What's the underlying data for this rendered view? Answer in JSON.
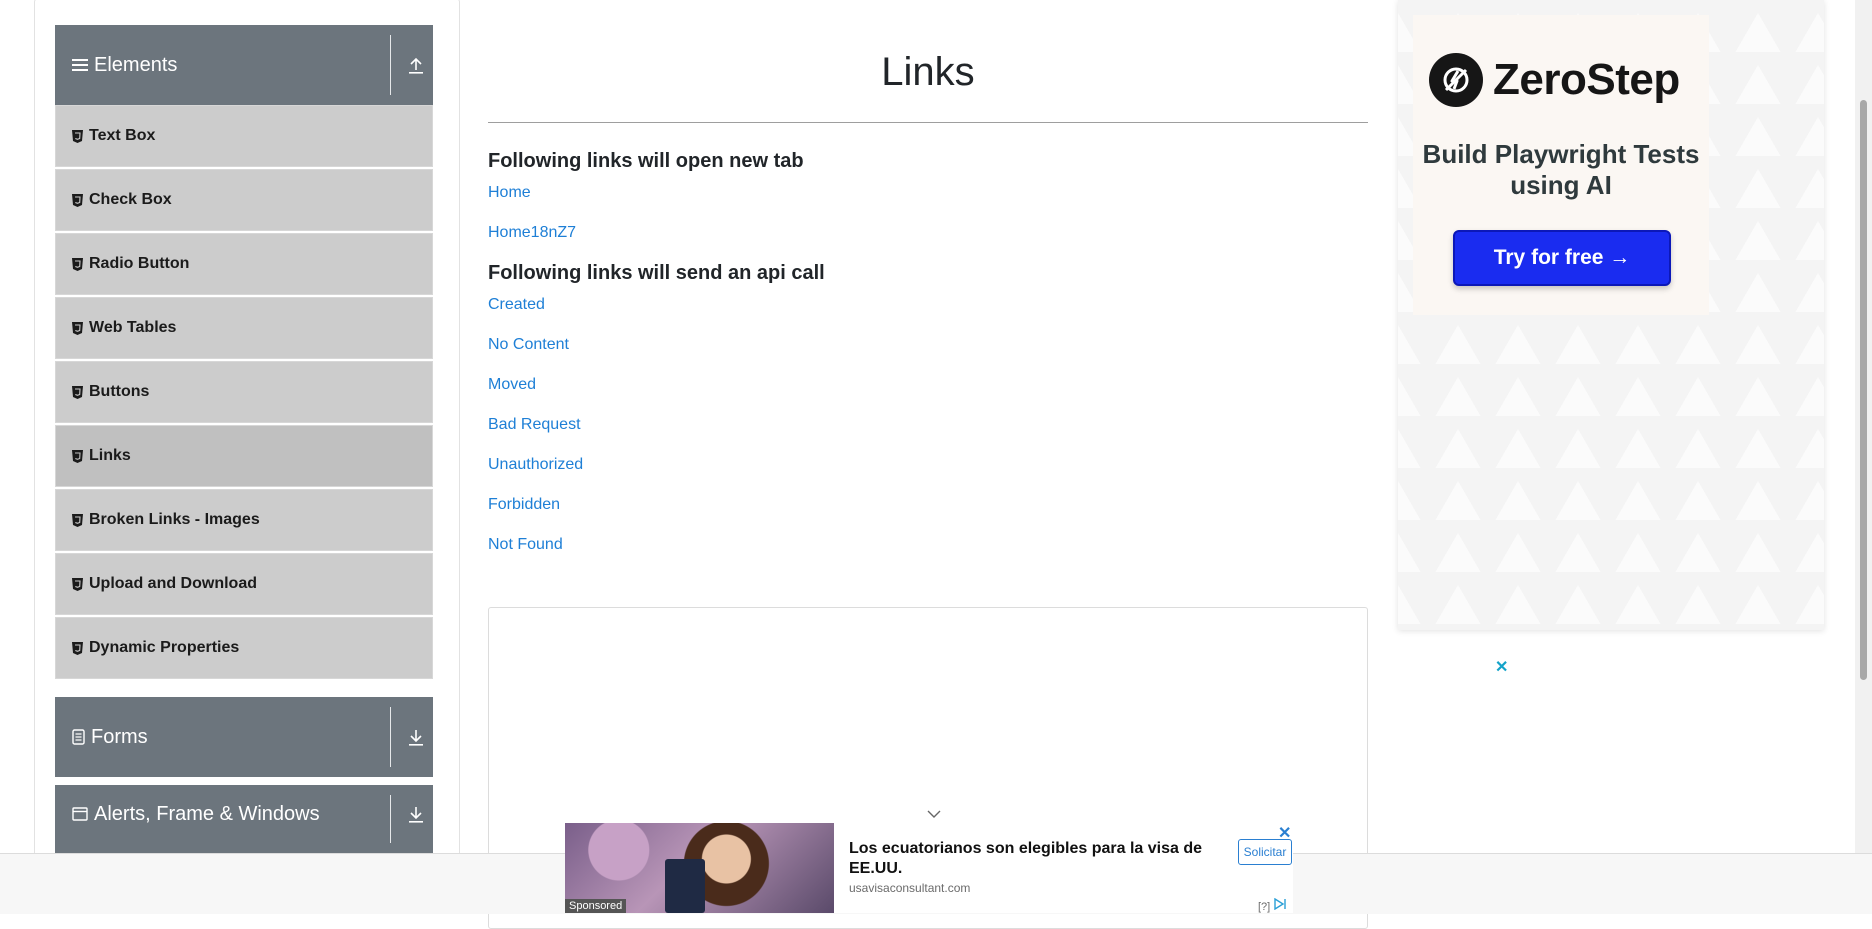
{
  "sidebar": {
    "elements_header": "Elements",
    "items": [
      {
        "label": "Text Box"
      },
      {
        "label": "Check Box"
      },
      {
        "label": "Radio Button"
      },
      {
        "label": "Web Tables"
      },
      {
        "label": "Buttons"
      },
      {
        "label": "Links"
      },
      {
        "label": "Broken Links - Images"
      },
      {
        "label": "Upload and Download"
      },
      {
        "label": "Dynamic Properties"
      }
    ],
    "active_item": "Links",
    "forms_header": "Forms",
    "alerts_header": "Alerts, Frame & Windows"
  },
  "main": {
    "title": "Links",
    "new_tab_heading": "Following links will open new tab",
    "new_tab_links": [
      "Home",
      "Home18nZ7"
    ],
    "api_heading": "Following links will send an api call",
    "api_links": [
      "Created",
      "No Content",
      "Moved",
      "Bad Request",
      "Unauthorized",
      "Forbidden",
      "Not Found"
    ]
  },
  "right_ad": {
    "brand": "ZeroStep",
    "headline": "Build Playwright Tests using AI",
    "cta": "Try for free →"
  },
  "sponsored": {
    "label": "Sponsored",
    "headline": "Los ecuatorianos son elegibles para la visa de EE.UU.",
    "domain": "usavisaconsultant.com",
    "cta": "Solicitar",
    "info": "[?]"
  },
  "colors": {
    "sidebar_header": "#6c757d",
    "menu_item": "#cccccc",
    "link": "#1e7fd6",
    "zerostep_cta": "#1a2cf0"
  }
}
